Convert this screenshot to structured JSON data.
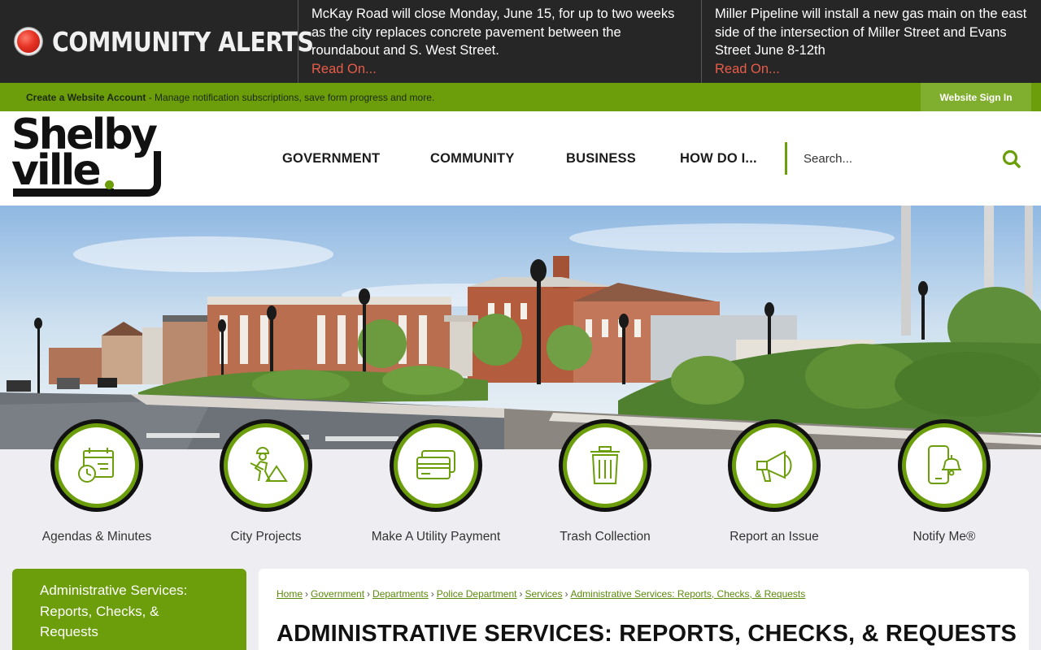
{
  "alerts": {
    "title": "COMMUNITY ALERTS",
    "items": [
      {
        "text": "McKay Road will close Monday, June 15, for up to two weeks as the city replaces concrete pavement between the roundabout and S. West Street.",
        "link": "Read On..."
      },
      {
        "text": "Miller Pipeline will install a new gas main on the east side of the intersection of Miller Street and Evans Street June 8-12th",
        "link": "Read On..."
      }
    ]
  },
  "account": {
    "create_label": "Create a Website Account",
    "description": " - Manage notification subscriptions, save form progress and more.",
    "signin_label": "Website Sign In"
  },
  "header": {
    "logo_line1": "Shelby",
    "logo_line2": "ville",
    "nav": [
      "GOVERNMENT",
      "COMMUNITY",
      "BUSINESS",
      "HOW DO I..."
    ],
    "search_placeholder": "Search..."
  },
  "quick_links": [
    {
      "label": "Agendas & Minutes",
      "icon": "calendar-clock-icon"
    },
    {
      "label": "City Projects",
      "icon": "construction-worker-icon"
    },
    {
      "label": "Make A Utility Payment",
      "icon": "credit-card-icon"
    },
    {
      "label": "Trash Collection",
      "icon": "trash-can-icon"
    },
    {
      "label": "Report an Issue",
      "icon": "megaphone-icon"
    },
    {
      "label": "Notify Me®",
      "icon": "phone-bell-icon"
    }
  ],
  "sidebar": {
    "lines": [
      "Administrative Services:",
      "Reports, Checks, &",
      "Requests"
    ]
  },
  "breadcrumb": [
    "Home",
    "Government",
    "Departments",
    "Police Department",
    "Services",
    "Administrative Services: Reports, Checks, & Requests"
  ],
  "page_title": "ADMINISTRATIVE SERVICES: REPORTS, CHECKS, & REQUESTS",
  "colors": {
    "brand_green": "#6b9e0a",
    "alert_bg": "#262626",
    "read_on": "#e85c4a"
  }
}
